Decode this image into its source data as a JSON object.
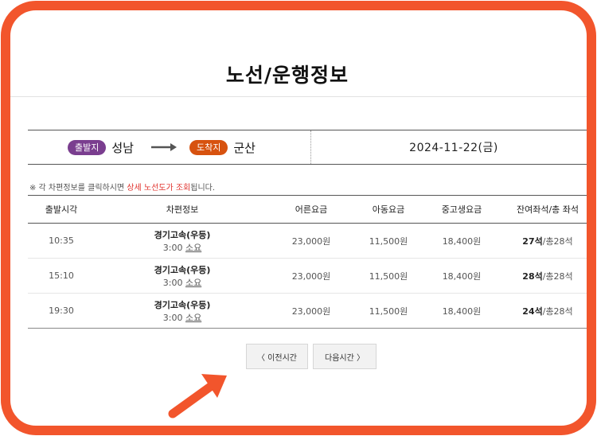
{
  "page": {
    "title": "노선/운행정보"
  },
  "route": {
    "depart_badge": "출발지",
    "depart_city": "성남",
    "arrive_badge": "도착지",
    "arrive_city": "군산",
    "date": "2024-11-22(금)"
  },
  "notice": {
    "prefix": "※ 각 차편정보를 클릭하시면 ",
    "highlight": "상세 노선도가 조회",
    "suffix": "됩니다."
  },
  "table": {
    "headers": [
      "출발시각",
      "차편정보",
      "어른요금",
      "아동요금",
      "중고생요금",
      "잔여좌석/총 좌석"
    ],
    "rows": [
      {
        "time": "10:35",
        "bus": "경기고속(우등)",
        "duration": "3:00",
        "duration_unit": "소요",
        "adult": "23,000원",
        "child": "11,500원",
        "youth": "18,400원",
        "seats_remaining": "27석",
        "seats_total": "/총28석"
      },
      {
        "time": "15:10",
        "bus": "경기고속(우등)",
        "duration": "3:00",
        "duration_unit": "소요",
        "adult": "23,000원",
        "child": "11,500원",
        "youth": "18,400원",
        "seats_remaining": "28석",
        "seats_total": "/총28석"
      },
      {
        "time": "19:30",
        "bus": "경기고속(우등)",
        "duration": "3:00",
        "duration_unit": "소요",
        "adult": "23,000원",
        "child": "11,500원",
        "youth": "18,400원",
        "seats_remaining": "24석",
        "seats_total": "/총28석"
      }
    ]
  },
  "pager": {
    "prev_label": "〈 이전시간",
    "next_label": "다음시간 〉"
  },
  "colors": {
    "frame": "#f2552c",
    "depart_badge": "#7a3e8f",
    "arrive_badge": "#d7520f",
    "highlight": "#e0302b",
    "pointer_arrow": "#f2552c"
  },
  "icons": {
    "route_arrow": "right-arrow-icon",
    "annotation": "pointer-arrow-icon"
  }
}
